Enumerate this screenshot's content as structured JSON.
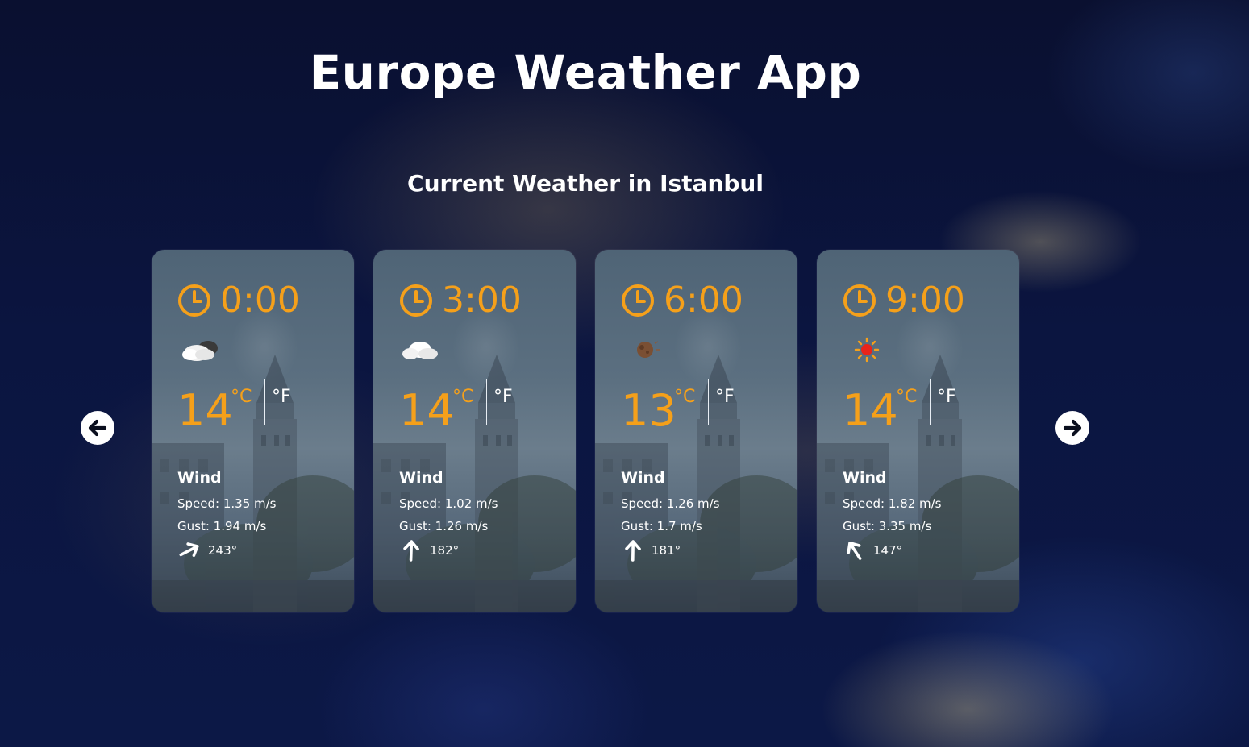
{
  "app": {
    "title": "Europe Weather App",
    "subtitle": "Current Weather in Istanbul"
  },
  "navigation": {
    "prev_icon": "arrow-left-circle-icon",
    "next_icon": "arrow-right-circle-icon"
  },
  "colors": {
    "accent": "#f5a01a",
    "text": "#ffffff",
    "background": "#0b1540"
  },
  "forecast": [
    {
      "time": "0:00",
      "condition_icon": "cloud-moon-icon",
      "temperature": "14",
      "unit_c": "°C",
      "unit_f": "°F",
      "wind_label": "Wind",
      "speed": "Speed: 1.35 m/s",
      "gust": "Gust: 1.94 m/s",
      "direction": "243°",
      "direction_deg": 243
    },
    {
      "time": "3:00",
      "condition_icon": "cloud-icon",
      "temperature": "14",
      "unit_c": "°C",
      "unit_f": "°F",
      "wind_label": "Wind",
      "speed": "Speed: 1.02 m/s",
      "gust": "Gust: 1.26 m/s",
      "direction": "182°",
      "direction_deg": 182
    },
    {
      "time": "6:00",
      "condition_icon": "brown-moon-icon",
      "temperature": "13",
      "unit_c": "°C",
      "unit_f": "°F",
      "wind_label": "Wind",
      "speed": "Speed: 1.26 m/s",
      "gust": "Gust: 1.7 m/s",
      "direction": "181°",
      "direction_deg": 181
    },
    {
      "time": "9:00",
      "condition_icon": "sun-icon",
      "temperature": "14",
      "unit_c": "°C",
      "unit_f": "°F",
      "wind_label": "Wind",
      "speed": "Speed: 1.82 m/s",
      "gust": "Gust: 3.35 m/s",
      "direction": "147°",
      "direction_deg": 147
    }
  ]
}
